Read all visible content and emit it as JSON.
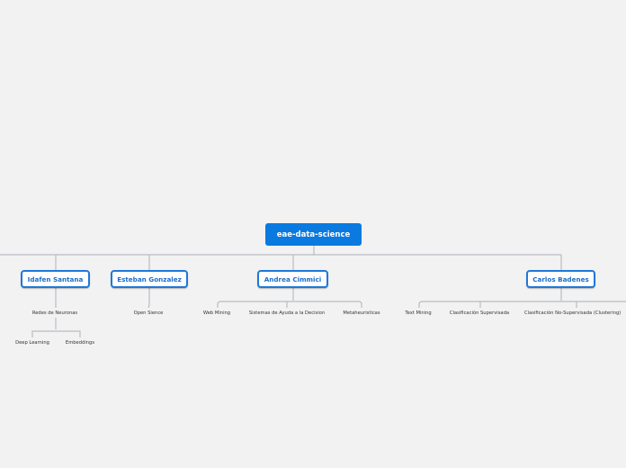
{
  "root": {
    "label": "eae-data-science"
  },
  "topics": [
    {
      "label": "Idafen Santana",
      "children": [
        {
          "label": "Redes de Neuronas",
          "children": [
            {
              "label": "Deep Learning"
            },
            {
              "label": "Embeddings"
            }
          ]
        }
      ]
    },
    {
      "label": "Esteban Gonzalez",
      "children": [
        {
          "label": "Open Sience"
        }
      ]
    },
    {
      "label": "Andrea Cimmici",
      "children": [
        {
          "label": "Web Mining"
        },
        {
          "label": "Sistemas de Ayuda a la Decision"
        },
        {
          "label": "Metaheuristicas"
        }
      ]
    },
    {
      "label": "Carlos Badenes",
      "children": [
        {
          "label": "Text Mining"
        },
        {
          "label": "Clasificación Supervisada"
        },
        {
          "label": "Clasificación No-Supervisada (Clustering)"
        }
      ]
    }
  ]
}
